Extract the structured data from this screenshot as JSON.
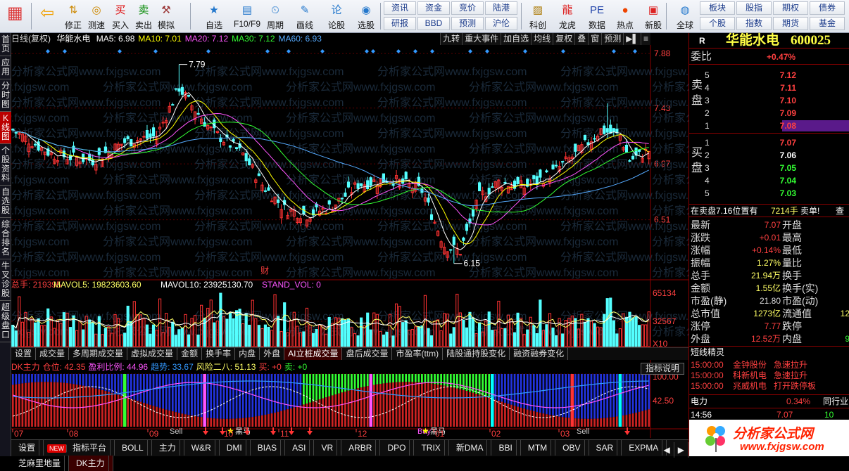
{
  "toolbar": {
    "buttons": [
      {
        "label": "",
        "icon": "grid-icon"
      },
      {
        "label": "",
        "icon": "back-arrow-icon"
      },
      {
        "label": "修正",
        "icon": "revise-icon"
      },
      {
        "label": "测速",
        "icon": "speedtest-icon"
      },
      {
        "label": "买入",
        "icon": "buy-icon"
      },
      {
        "label": "卖出",
        "icon": "sell-icon"
      },
      {
        "label": "模拟",
        "icon": "simulate-icon"
      },
      {
        "label": "自选",
        "icon": "watchlist-icon"
      },
      {
        "label": "F10/F9",
        "icon": "f10-icon"
      },
      {
        "label": "周期",
        "icon": "cycle-icon"
      },
      {
        "label": "画线",
        "icon": "drawline-icon"
      },
      {
        "label": "论股",
        "icon": "discuss-icon"
      },
      {
        "label": "选股",
        "icon": "stockpick-icon"
      },
      {
        "label": "科创",
        "icon": "sci-tech-icon"
      },
      {
        "label": "龙虎",
        "icon": "dragon-tiger-icon"
      },
      {
        "label": "数据",
        "icon": "data-icon"
      },
      {
        "label": "热点",
        "icon": "hotspot-icon"
      },
      {
        "label": "新股",
        "icon": "new-stock-icon"
      },
      {
        "label": "全球",
        "icon": "globe-icon"
      }
    ],
    "text_buttons": [
      "资讯",
      "资金",
      "竞价",
      "陆港",
      "研报",
      "BBD",
      "预测",
      "沪伦",
      "板块",
      "股指",
      "期权",
      "债券",
      "个股",
      "指数",
      "期货",
      "基金"
    ]
  },
  "left_nav": [
    "首页",
    "应用",
    "分时图",
    "K线图",
    "个股资料",
    "自选股",
    "综合排名",
    "牛叉诊股",
    "超级盘口"
  ],
  "chart": {
    "title": "日线(复权)",
    "stock_name": "华能水电",
    "ma": [
      {
        "label": "MA5: 6.98",
        "color": "#ffffff"
      },
      {
        "label": "MA10: 7.01",
        "color": "#ffff00"
      },
      {
        "label": "MA20: 7.12",
        "color": "#ff55ff"
      },
      {
        "label": "MA30: 7.12",
        "color": "#33ff33"
      },
      {
        "label": "MA60: 6.93",
        "color": "#55aaff"
      }
    ],
    "top_buttons": [
      "九转",
      "重大事件",
      "加自选",
      "均线",
      "复权",
      "叠",
      "窗",
      "预测"
    ],
    "price_axis": [
      "7.88",
      "7.43",
      "6.97",
      "6.51"
    ],
    "high_label": "7.79",
    "low_label": "6.15",
    "caijing_mark": "财",
    "watermark": "分析家公式网www.fxjgsw.com",
    "volume_header": [
      {
        "label": "总手: 219395",
        "color": "#ff4040"
      },
      {
        "label": "MAVOL5: 19823603.60",
        "color": "#ffff66"
      },
      {
        "label": "MAVOL10: 23925130.70",
        "color": "#ffffff"
      },
      {
        "label": "STAND_VOL: 0",
        "color": "#ff55ff"
      }
    ],
    "volume_axis": [
      "65134",
      "32567",
      "X10"
    ],
    "indicator_tabs": [
      "设置",
      "成交量",
      "多周期成交量",
      "虚拟成交量",
      "金额",
      "换手率",
      "内盘",
      "外盘",
      "AI立桩成交量",
      "盘后成交量",
      "市盈率(ttm)",
      "陆股通持股变化",
      "融资融券变化"
    ],
    "active_indicator_tab": "AI立桩成交量",
    "dk_header": [
      {
        "label": "DK主力",
        "color": "#ff4040"
      },
      {
        "label": "仓位: 42.35",
        "color": "#ff4040"
      },
      {
        "label": "盈利比例: 44.96",
        "color": "#ff55ff"
      },
      {
        "label": "趋势: 33.67",
        "color": "#3399ff"
      },
      {
        "label": "风险二八: 51.13",
        "color": "#ffff66"
      },
      {
        "label": "买: +0",
        "color": "#ff4040"
      },
      {
        "label": "卖: +0",
        "color": "#33ff33"
      }
    ],
    "indicator_button": "指标说明",
    "dk_axis": [
      "100.00",
      "42.50"
    ],
    "dk_marks": [
      "Sell",
      "黑马",
      "Sell",
      "Buy",
      "黑马"
    ],
    "months": [
      "07",
      "08",
      "09",
      "10",
      "11",
      "12",
      "01",
      "02",
      "03"
    ]
  },
  "bottom_tabs": [
    "设置",
    "指标平台",
    "BOLL",
    "主力",
    "W&R",
    "DMI",
    "BIAS",
    "ASI",
    "VR",
    "ARBR",
    "DPO",
    "TRIX",
    "新DMA",
    "BBI",
    "MTM",
    "OBV",
    "SAR",
    "EXPMA",
    "芝麻里地量",
    "DK主力"
  ],
  "bottom_new_badge": "NEW",
  "bottom_active": "DK主力",
  "quote": {
    "code_marker": "R",
    "name": "华能水电",
    "code": "600025",
    "weibi_label": "委比",
    "weibi_value": "+0.47%",
    "sell_label": "卖盘",
    "buy_label": "买盘",
    "asks": [
      {
        "n": "5",
        "price": "7.12",
        "vol": ""
      },
      {
        "n": "4",
        "price": "7.11",
        "vol": ""
      },
      {
        "n": "3",
        "price": "7.10",
        "vol": ""
      },
      {
        "n": "2",
        "price": "7.09",
        "vol": ""
      },
      {
        "n": "1",
        "price": "7.08",
        "vol": ""
      }
    ],
    "bids": [
      {
        "n": "1",
        "price": "7.07",
        "vol": ""
      },
      {
        "n": "2",
        "price": "7.06",
        "vol": ""
      },
      {
        "n": "3",
        "price": "7.05",
        "vol": ""
      },
      {
        "n": "4",
        "price": "7.04",
        "vol": ""
      },
      {
        "n": "5",
        "price": "7.03",
        "vol": ""
      }
    ],
    "pending_text": "在卖盘7.16位置有",
    "pending_qty": "7214手",
    "pending_tag": "卖单!",
    "pending_more": "查",
    "stats": [
      {
        "l1": "最新",
        "v1": "7.07",
        "c1": "#ff4040",
        "l2": "开盘",
        "v2": ""
      },
      {
        "l1": "涨跌",
        "v1": "+0.01",
        "c1": "#ff4040",
        "l2": "最高",
        "v2": ""
      },
      {
        "l1": "涨幅",
        "v1": "+0.14%",
        "c1": "#ff4040",
        "l2": "最低",
        "v2": ""
      },
      {
        "l1": "振幅",
        "v1": "1.27%",
        "c1": "#ffff66",
        "l2": "量比",
        "v2": ""
      },
      {
        "l1": "总手",
        "v1": "21.94万",
        "c1": "#ffff66",
        "l2": "换手",
        "v2": ""
      },
      {
        "l1": "金额",
        "v1": "1.55亿",
        "c1": "#ffff66",
        "l2": "换手(实)",
        "v2": "",
        "c2": "#ffff66"
      },
      {
        "l1": "市盈(静)",
        "v1": "21.80",
        "c1": "#dddddd",
        "l2": "市盈(动)",
        "v2": ""
      },
      {
        "l1": "总市值",
        "v1": "1273亿",
        "c1": "#ffff66",
        "l2": "流通值",
        "v2": "12",
        "c2": "#ffff66"
      },
      {
        "l1": "涨停",
        "v1": "7.77",
        "c1": "#ff4040",
        "l2": "跌停",
        "v2": ""
      },
      {
        "l1": "外盘",
        "v1": "12.52万",
        "c1": "#ff4040",
        "l2": "内盘",
        "v2": "9",
        "c2": "#33ff33"
      }
    ],
    "news_title": "短线精灵",
    "news": [
      {
        "time": "15:00:00",
        "name": "金钟股份",
        "event": "急速拉升"
      },
      {
        "time": "15:00:00",
        "name": "科新机电",
        "event": "急速拉升"
      },
      {
        "time": "15:00:00",
        "name": "兆威机电",
        "event": "打开跌停板"
      }
    ],
    "sector_name": "电力",
    "sector_pct": "0.34%",
    "sector_link": "同行业",
    "tick_time": "14:56",
    "tick_price": "7.07",
    "tick_vol": "10",
    "logo_text": "分析家公式网",
    "logo_url": "www.fxjgsw.com"
  },
  "colors": {
    "up": "#ff3232",
    "down": "#54ffff",
    "ma5": "#ffffff",
    "ma10": "#ffff00",
    "ma20": "#ff55ff",
    "ma30": "#33ff33",
    "ma60": "#55aaff"
  }
}
